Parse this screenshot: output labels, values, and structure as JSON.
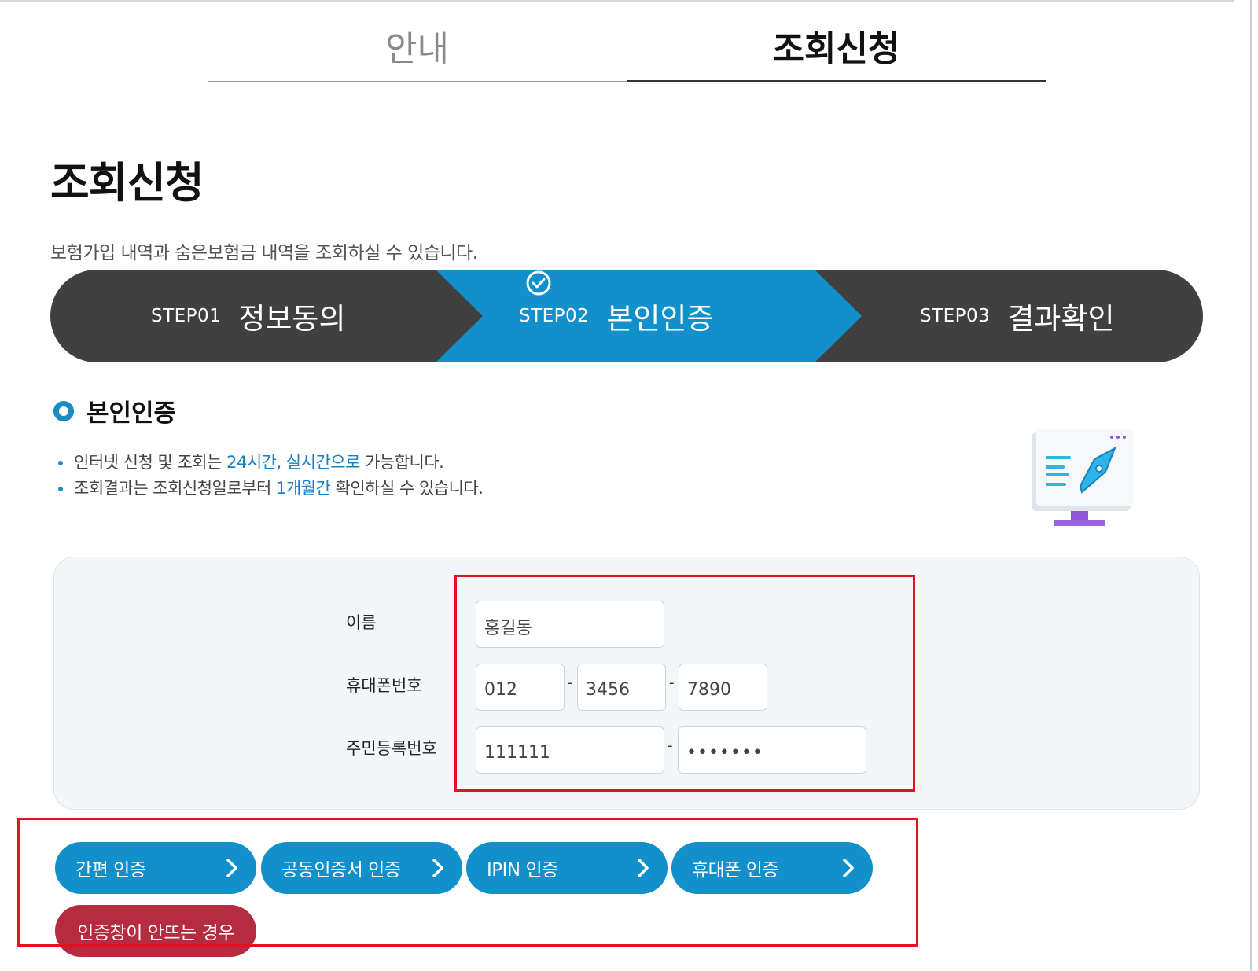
{
  "tabs": [
    {
      "label": "안내",
      "active": false
    },
    {
      "label": "조회신청",
      "active": true
    }
  ],
  "page": {
    "title": "조회신청",
    "description": "보험가입 내역과 숨은보험금 내역을 조회하실 수 있습니다."
  },
  "steps": [
    {
      "num": "STEP01",
      "name": "정보동의",
      "active": false
    },
    {
      "num": "STEP02",
      "name": "본인인증",
      "active": true
    },
    {
      "num": "STEP03",
      "name": "결과확인",
      "active": false
    }
  ],
  "colors": {
    "step_dark": "#404040",
    "step_active": "#1290cb",
    "accent": "#1a8bc4",
    "warn": "#b52b3f",
    "annotation": "#e0141e"
  },
  "section": {
    "title": "본인인증",
    "notes": [
      {
        "a": "인터넷 신청 및 조회는 ",
        "b": "24시간, 실시간으로",
        "c": " 가능합니다."
      },
      {
        "a": "조회결과는 조회신청일로부터 ",
        "b": "1개월간",
        "c": " 확인하실 수 있습니다."
      }
    ]
  },
  "form": {
    "name_label": "이름",
    "name_value": "홍길동",
    "phone_label": "휴대폰번호",
    "phone": [
      "012",
      "3456",
      "7890"
    ],
    "rrn_label": "주민등록번호",
    "rrn_front": "111111",
    "rrn_back": "•••••••",
    "dash": "-"
  },
  "auth_buttons": [
    {
      "label": "간편 인증"
    },
    {
      "label": "공동인증서 인증"
    },
    {
      "label": "IPIN 인증"
    },
    {
      "label": "휴대폰 인증"
    }
  ],
  "warn_button": {
    "label": "인증창이 안뜨는 경우"
  }
}
